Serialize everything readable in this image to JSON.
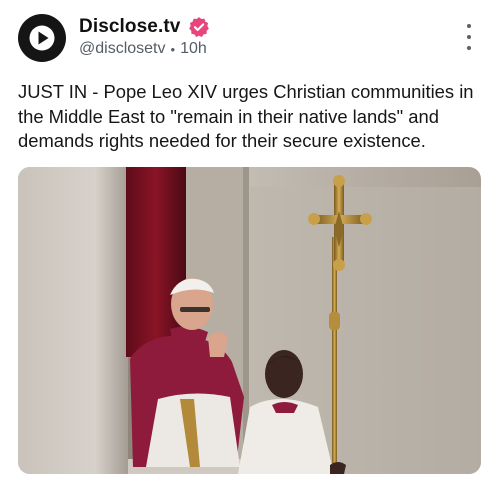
{
  "post": {
    "author": {
      "display_name": "Disclose.tv",
      "handle": "@disclosetv",
      "verified": true,
      "avatar_icon": "play-logo-icon"
    },
    "time_ago": "10h",
    "separator": "•",
    "text": "JUST IN - Pope Leo XIV urges Christian communities in the Middle East to \"remain in their native lands\" and demands rights needed for their secure existence.",
    "more_icon": "more-vertical-icon",
    "media": {
      "kind": "photo"
    }
  },
  "colors": {
    "verified_badge": "#e8457c",
    "avatar_bg": "#151515",
    "secondary_text": "#555c63"
  }
}
